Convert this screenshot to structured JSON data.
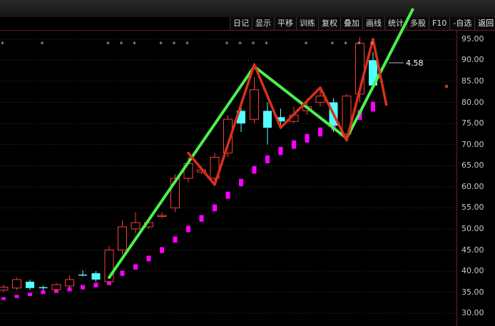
{
  "toolbar": {
    "buttons": [
      "日记",
      "显示",
      "平移",
      "训练",
      "复权",
      "叠加",
      "画线",
      "统计",
      "多股",
      "F10",
      "-自选",
      "返回"
    ]
  },
  "price_marker": "4.58",
  "chart_data": {
    "type": "candlestick",
    "ylim": [
      27,
      97
    ],
    "y_ticks": [
      30,
      35,
      40,
      45,
      50,
      55,
      60,
      65,
      70,
      75,
      80,
      85,
      90,
      95
    ],
    "candles": [
      {
        "o": 35.5,
        "c": 36.2,
        "h": 36.8,
        "l": 35.0,
        "up": true
      },
      {
        "o": 36.0,
        "c": 38.0,
        "h": 38.5,
        "l": 35.5,
        "up": true
      },
      {
        "o": 37.5,
        "c": 36.0,
        "h": 38.0,
        "l": 35.5,
        "up": false
      },
      {
        "o": 36.2,
        "c": 36.0,
        "h": 36.6,
        "l": 35.4,
        "up": false
      },
      {
        "o": 35.6,
        "c": 36.8,
        "h": 37.2,
        "l": 35.2,
        "up": true
      },
      {
        "o": 36.5,
        "c": 38.0,
        "h": 39.0,
        "l": 36.0,
        "up": true
      },
      {
        "o": 39.2,
        "c": 39.0,
        "h": 40.2,
        "l": 38.7,
        "up": false
      },
      {
        "o": 39.5,
        "c": 38.0,
        "h": 40.0,
        "l": 37.5,
        "up": false
      },
      {
        "o": 37.5,
        "c": 45.0,
        "h": 46.0,
        "l": 37.0,
        "up": true
      },
      {
        "o": 45.0,
        "c": 50.5,
        "h": 52.0,
        "l": 44.0,
        "up": true
      },
      {
        "o": 50.0,
        "c": 51.5,
        "h": 54.0,
        "l": 49.0,
        "up": true
      },
      {
        "o": 50.5,
        "c": 51.5,
        "h": 52.5,
        "l": 50.0,
        "up": true
      },
      {
        "o": 53.0,
        "c": 53.2,
        "h": 54.0,
        "l": 52.5,
        "up": true
      },
      {
        "o": 55.0,
        "c": 62.0,
        "h": 63.0,
        "l": 54.0,
        "up": true
      },
      {
        "o": 62.0,
        "c": 65.5,
        "h": 67.0,
        "l": 61.0,
        "up": true
      },
      {
        "o": 64.0,
        "c": 63.5,
        "h": 65.0,
        "l": 63.0,
        "up": true
      },
      {
        "o": 62.0,
        "c": 67.0,
        "h": 68.0,
        "l": 61.0,
        "up": true
      },
      {
        "o": 68.0,
        "c": 76.0,
        "h": 77.0,
        "l": 67.0,
        "up": true
      },
      {
        "o": 78.0,
        "c": 75.0,
        "h": 80.0,
        "l": 73.0,
        "up": false
      },
      {
        "o": 76.0,
        "c": 83.0,
        "h": 86.0,
        "l": 75.0,
        "up": true
      },
      {
        "o": 78.0,
        "c": 74.0,
        "h": 80.0,
        "l": 70.0,
        "up": false
      },
      {
        "o": 75.5,
        "c": 76.5,
        "h": 78.5,
        "l": 74.5,
        "up": false
      },
      {
        "o": 75.5,
        "c": 77.0,
        "h": 79.0,
        "l": 75.0,
        "up": true
      },
      {
        "o": 78.0,
        "c": 79.0,
        "h": 81.0,
        "l": 77.0,
        "up": true
      },
      {
        "o": 80.0,
        "c": 81.5,
        "h": 83.0,
        "l": 79.0,
        "up": true
      },
      {
        "o": 80.0,
        "c": 74.5,
        "h": 81.0,
        "l": 73.0,
        "up": false
      },
      {
        "o": 72.5,
        "c": 81.5,
        "h": 82.0,
        "l": 72.0,
        "up": true
      },
      {
        "o": 82.0,
        "c": 94.0,
        "h": 95.5,
        "l": 80.0,
        "up": true
      },
      {
        "o": 90.0,
        "c": 84.0,
        "h": 92.0,
        "l": 83.0,
        "up": false
      }
    ],
    "dots": [
      33.5,
      34.0,
      34.5,
      35.0,
      35.3,
      35.7,
      36.2,
      36.7,
      37.3,
      39.5,
      41.0,
      43.0,
      45.0,
      47.5,
      50.0,
      52.5,
      55.0,
      58.0,
      61.0,
      64.0,
      66.5,
      68.5,
      70.0,
      71.5,
      73.0,
      74.5,
      75.5,
      77.0,
      79.0
    ],
    "green_line": [
      [
        8,
        38.5
      ],
      [
        19,
        88.5
      ],
      [
        26,
        71.5
      ],
      [
        31,
        102.0
      ]
    ],
    "red_line": [
      [
        14,
        68.0
      ],
      [
        16,
        60.5
      ],
      [
        19,
        89.0
      ],
      [
        21,
        74.0
      ],
      [
        24,
        83.5
      ],
      [
        26,
        71.0
      ],
      [
        28,
        95.0
      ],
      [
        29,
        79.5
      ]
    ],
    "star_slots": [
      0,
      3,
      8,
      9,
      10,
      12,
      13,
      14,
      17,
      18,
      19,
      20,
      23,
      25,
      26,
      27,
      28
    ]
  }
}
